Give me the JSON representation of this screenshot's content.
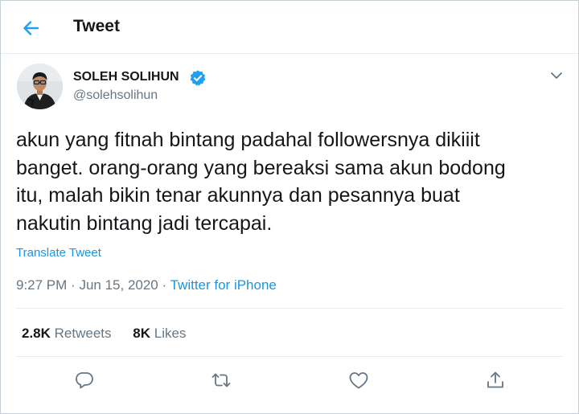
{
  "header": {
    "title": "Tweet",
    "back_icon": "arrow-left-icon"
  },
  "author": {
    "name": "SOLEH SOLIHUN",
    "handle": "@solehsolihun",
    "verified_icon": "verified-badge-icon",
    "avatar_icon": "avatar-photo"
  },
  "tweet": {
    "text_lines": [
      "akun yang fitnah bintang padahal followersnya dikiiit",
      "banget. orang-orang yang bereaksi sama akun bodong",
      "itu, malah bikin tenar akunnya dan pesannya buat",
      "nakutin bintang jadi tercapai."
    ],
    "translate_label": "Translate Tweet",
    "time": "9:27 PM",
    "separator": "·",
    "date": "Jun 15, 2020",
    "source": "Twitter for iPhone"
  },
  "stats": {
    "retweets_count": "2.8K",
    "retweets_label": "Retweets",
    "likes_count": "8K",
    "likes_label": "Likes"
  },
  "actions": [
    {
      "icon": "reply-icon"
    },
    {
      "icon": "retweet-icon"
    },
    {
      "icon": "like-heart-icon"
    },
    {
      "icon": "share-icon"
    }
  ],
  "colors": {
    "accent": "#1da1f2",
    "link": "#1b95e0",
    "text": "#14171a",
    "muted": "#657786",
    "border": "#e6ecf0"
  }
}
